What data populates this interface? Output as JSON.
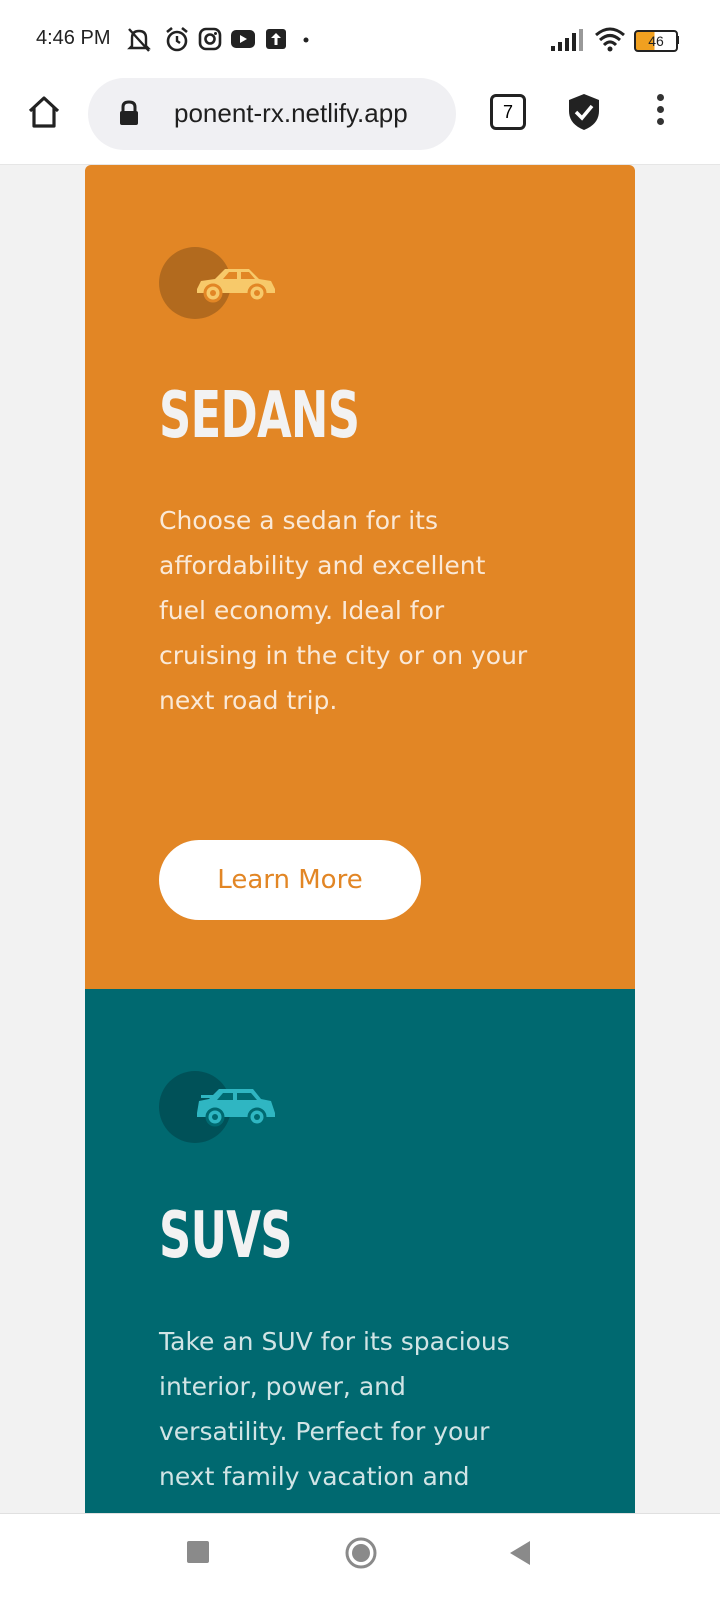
{
  "status_bar": {
    "time": "4:46 PM",
    "battery_level": "46",
    "icons": [
      "notifications-off-icon",
      "alarm-icon",
      "instagram-icon",
      "youtube-icon",
      "upload-icon",
      "dot-icon",
      "signal-icon",
      "wifi-icon",
      "battery-icon"
    ]
  },
  "browser": {
    "url": "ponent-rx.netlify.app",
    "tab_count": "7",
    "icons": [
      "home-icon",
      "lock-icon",
      "shield-check-icon",
      "more-vert-icon"
    ]
  },
  "cards": [
    {
      "id": "sedans",
      "title": "SEDANS",
      "text": "Choose a sedan for its affordability and excellent fuel economy. Ideal for cruising in the city or on your next road trip.",
      "button_label": "Learn More",
      "icon": "sedan-car-icon",
      "background": "#e28625"
    },
    {
      "id": "suvs",
      "title": "SUVS",
      "text": "Take an SUV for its spacious interior, power, and versatility. Perfect for your next family vacation and",
      "icon": "suv-car-icon",
      "background": "#006970"
    }
  ],
  "nav_bar": {
    "icons": [
      "recents-square-icon",
      "home-circle-icon",
      "back-triangle-icon"
    ]
  },
  "colors": {
    "sedan_orange": "#e28625",
    "suv_teal": "#006970",
    "page_background": "#f2f2f2"
  }
}
